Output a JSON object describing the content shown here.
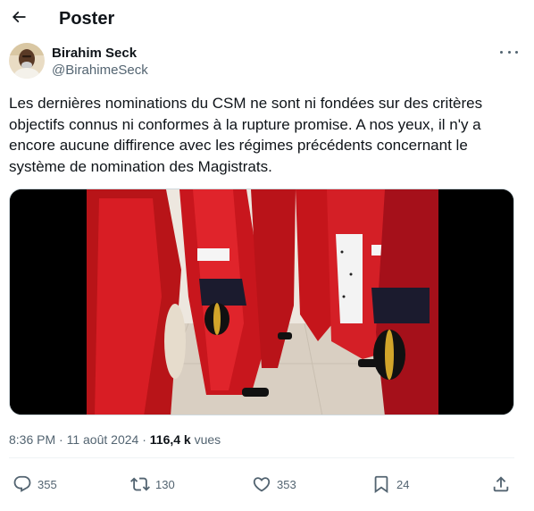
{
  "header": {
    "title": "Poster",
    "back_icon": "arrow-left-icon"
  },
  "author": {
    "name": "Birahim Seck",
    "handle": "@BirahimeSeck",
    "avatar_icon": "avatar-photo",
    "more_icon": "more-horizontal-icon"
  },
  "tweet": {
    "text": "Les dernières nominations du CSM ne sont ni fondées sur des critères\nobjectifs connus ni conformes à la rupture promise. A nos yeux, il n'y a\nencore aucune diffirence avec les régimes précédents concernant le\nsystème de nomination des Magistrats.",
    "media_icon": "photo-magistrates-red-robes"
  },
  "meta": {
    "time": "8:36 PM",
    "separator": " · ",
    "date": "11 août 2024",
    "separator2": " · ",
    "views_count": "116,4 k",
    "views_label": " vues"
  },
  "actions": {
    "replies": "355",
    "reposts": "130",
    "likes": "353",
    "bookmarks": "24"
  },
  "colors": {
    "text": "#0f1419",
    "secondary": "#536471",
    "divider": "#eff3f4",
    "robe_red": "#c8161d"
  }
}
